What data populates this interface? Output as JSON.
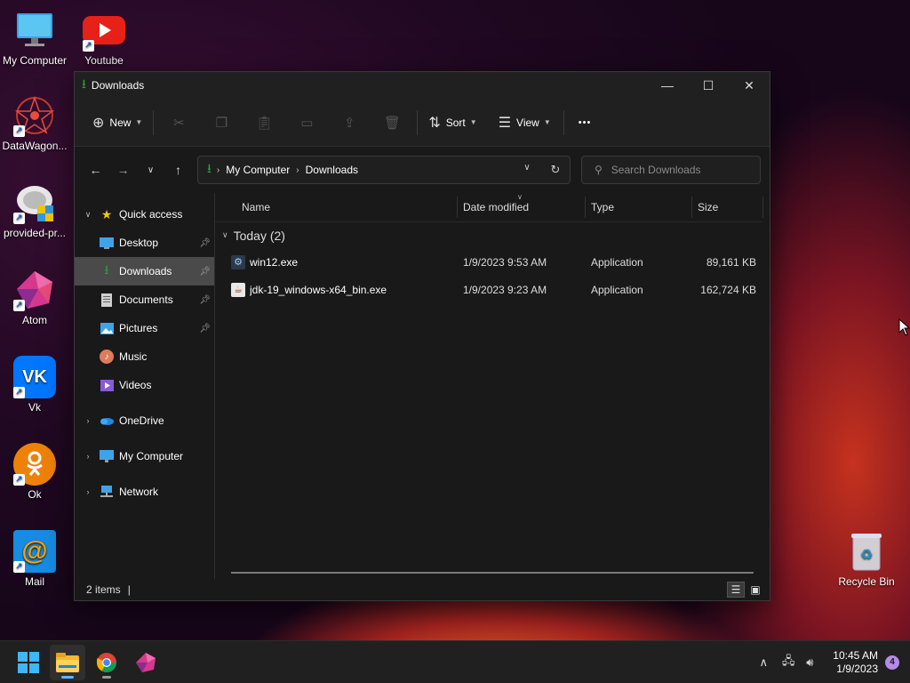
{
  "desktop": {
    "icons": [
      {
        "label": "My Computer"
      },
      {
        "label": "Youtube"
      },
      {
        "label": "DataWagon..."
      },
      {
        "label": "provided-pr..."
      },
      {
        "label": "Atom"
      },
      {
        "label": "Vk"
      },
      {
        "label": "Ok"
      },
      {
        "label": "Mail"
      },
      {
        "label": "Recycle Bin"
      }
    ]
  },
  "window": {
    "title": "Downloads",
    "controls": {
      "minimize": "—",
      "maximize": "☐",
      "close": "✕"
    }
  },
  "commandbar": {
    "new_label": "New",
    "sort_label": "Sort",
    "view_label": "View",
    "more_label": "•••"
  },
  "address": {
    "crumbs": [
      "My Computer",
      "Downloads"
    ]
  },
  "search": {
    "placeholder": "Search Downloads"
  },
  "navpane": {
    "quick_access": "Quick access",
    "items": [
      {
        "label": "Desktop"
      },
      {
        "label": "Downloads"
      },
      {
        "label": "Documents"
      },
      {
        "label": "Pictures"
      },
      {
        "label": "Music"
      },
      {
        "label": "Videos"
      }
    ],
    "onedrive": "OneDrive",
    "mycomputer": "My Computer",
    "network": "Network"
  },
  "files": {
    "columns": [
      "Name",
      "Date modified",
      "Type",
      "Size"
    ],
    "group": "Today (2)",
    "rows": [
      {
        "name": "win12.exe",
        "date": "1/9/2023 9:53 AM",
        "type": "Application",
        "size": "89,161 KB"
      },
      {
        "name": "jdk-19_windows-x64_bin.exe",
        "date": "1/9/2023 9:23 AM",
        "type": "Application",
        "size": "162,724 KB"
      }
    ]
  },
  "status": {
    "count": "2 items",
    "cursor": "|"
  },
  "taskbar": {
    "time": "10:45 AM",
    "date": "1/9/2023",
    "notifications": "4"
  },
  "colors": {
    "accent_green": "#2ea043",
    "selection": "#4a4a4a",
    "window_bg": "#191919"
  }
}
